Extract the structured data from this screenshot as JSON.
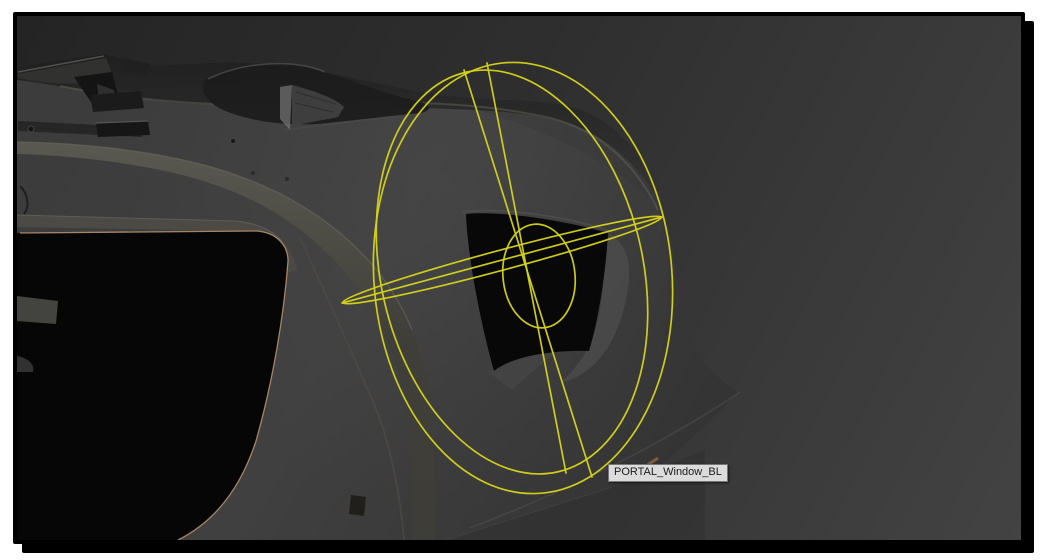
{
  "colors": {
    "page_bg": "#ffffff",
    "frame": "#000000",
    "gizmo": "#d6d41a",
    "tan_edge": "#bd9671",
    "tooltip_bg": "#dcdcdc",
    "tooltip_text": "#1c1c1c",
    "tooltip_border": "#757575"
  },
  "viewport": {
    "tooltip": {
      "text": "PORTAL_Window_BL"
    }
  }
}
